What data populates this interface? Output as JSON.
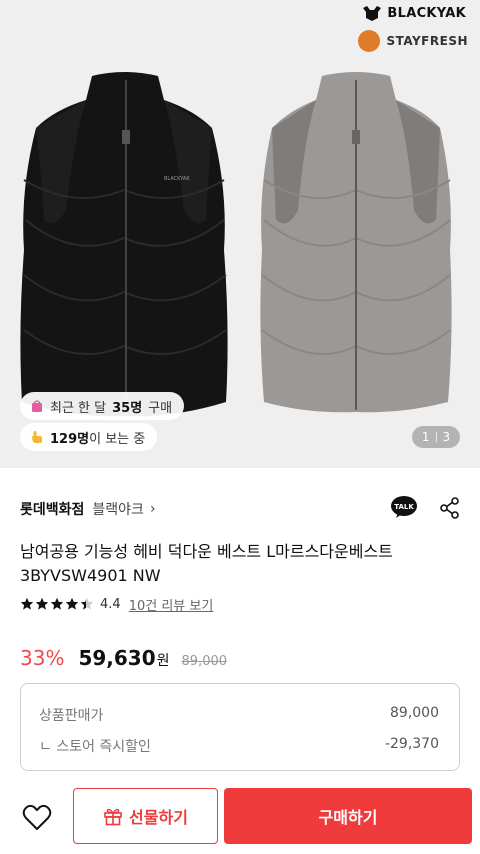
{
  "hero": {
    "brand_logo": "BLACKYAK",
    "sub_logo": "STAYFRESH",
    "recent_purchase": {
      "prefix": "최근 한 달",
      "count": "35명",
      "suffix": "구매"
    },
    "viewers": {
      "count": "129명",
      "suffix": "이 보는 중"
    },
    "pager": {
      "current": "1",
      "total": "3"
    },
    "vest_print": "BLACKYAK"
  },
  "store": {
    "name": "롯데백화점",
    "brand": "블랙야크",
    "chevron": "›",
    "talk_icon_label": "TALK"
  },
  "product": {
    "title": "남여공용 기능성 헤비 덕다운 베스트 L마르스다운베스트 3BYVSW4901 NW",
    "rating": "4.4",
    "rating_value": 4.4,
    "reviews": "10건 리뷰 보기"
  },
  "price": {
    "discount": "33%",
    "sale": "59,630",
    "unit": "원",
    "original": "89,000"
  },
  "breakdown": [
    {
      "label": "상품판매가",
      "value": "89,000"
    },
    {
      "label": "ㄴ 스토어 즉시할인",
      "value": "-29,370"
    }
  ],
  "actions": {
    "gift": "선물하기",
    "buy": "구매하기"
  },
  "colors": {
    "accent": "#ef3b3b",
    "discount": "#ef4b4b",
    "hero_bg": "#efefef"
  }
}
